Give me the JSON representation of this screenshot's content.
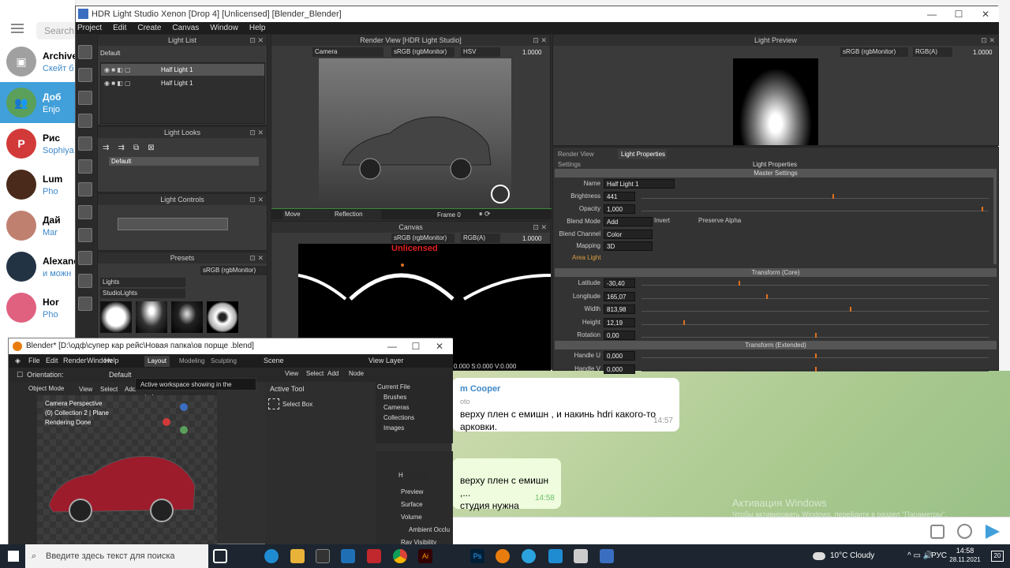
{
  "telegram": {
    "search_placeholder": "Search",
    "chats": [
      {
        "name": "Archive",
        "sub": "Скейт б",
        "color": "#a0a0a0",
        "initial": "▣"
      },
      {
        "name": "Доб",
        "sub": "Enjo",
        "color": "#5aa05a",
        "initial": "👥",
        "selected": true
      },
      {
        "name": "Рис",
        "sub": "Sophiya",
        "color": "#d23a3a",
        "initial": "P"
      },
      {
        "name": "Lum",
        "sub": "Pho",
        "color": "#4a2a1a",
        "initial": ""
      },
      {
        "name": "Дай",
        "sub": "Mar",
        "color": "#c08070",
        "initial": ""
      },
      {
        "name": "Alexand",
        "sub": "и можн",
        "color": "#223344",
        "initial": ""
      },
      {
        "name": "Hor",
        "sub": "Pho",
        "color": "#e06080",
        "initial": ""
      }
    ],
    "messages": [
      {
        "sender": "m Cooper",
        "sub": "oto",
        "text1": "верху плен с емишн , и накинь hdri какого-то",
        "text2": "арковки.",
        "time": "14:57"
      },
      {
        "text1": "верху плен с емишн ,...",
        "text2": "студия нужна",
        "time": "14:58"
      }
    ],
    "watermark1": "Активация Windows",
    "watermark2": "Чтобы активировать Windows, перейдите в раздел \"Параметры\"."
  },
  "hdr": {
    "title": "HDR Light Studio Xenon [Drop 4]  [Unlicensed] [Blender_Blender]",
    "menu": [
      "Project",
      "Edit",
      "Create",
      "Canvas",
      "Window",
      "Help"
    ],
    "light_list": {
      "title": "Light List",
      "group": "Default",
      "lights": [
        "Half Light 1",
        "Half Light 1"
      ]
    },
    "light_looks": {
      "title": "Light Looks",
      "item": "Default"
    },
    "light_controls": {
      "title": "Light Controls"
    },
    "presets": {
      "title": "Presets",
      "colorspace": "sRGB (rgbMonitor)",
      "category": "Lights",
      "sub": "StudioLights"
    },
    "render_view": {
      "title": "Render View [HDR Light Studio]",
      "camera": "Camera",
      "colorspace": "sRGB (rgbMonitor)",
      "mode": "HSV",
      "exposure": "1.0000",
      "move": "Move",
      "reflection": "Reflection",
      "frame": "Frame 0"
    },
    "canvas": {
      "title": "Canvas",
      "colorspace": "sRGB (rgbMonitor)",
      "mode": "RGB(A)",
      "exposure": "1.0000",
      "unlicensed": "Unlicensed",
      "coords": "0.000 S:0.000 V:0.000"
    },
    "light_preview": {
      "title": "Light Preview",
      "colorspace": "sRGB (rgbMonitor)",
      "mode": "RGB(A)",
      "exposure": "1.0000"
    },
    "tabs": [
      "Render View Settings",
      "Light Properties"
    ],
    "props": {
      "title": "Light Properties",
      "master": "Master Settings",
      "name_label": "Name",
      "name": "Half Light 1",
      "brightness_label": "Brightness",
      "brightness": "441",
      "opacity_label": "Opacity",
      "opacity": "1,000",
      "blend_mode_label": "Blend Mode",
      "blend_mode": "Add",
      "invert": "Invert",
      "preserve_alpha": "Preserve Alpha",
      "blend_channel_label": "Blend Channel",
      "blend_channel": "Color",
      "mapping_label": "Mapping",
      "mapping": "3D",
      "area_light": "Area Light",
      "transform_core": "Transform (Core)",
      "latitude_label": "Latitude",
      "latitude": "-30,40",
      "longitude_label": "Longitude",
      "longitude": "165,07",
      "width_label": "Width",
      "width": "813,98",
      "height_label": "Height",
      "height": "12,19",
      "rotation_label": "Rotation",
      "rotation": "0,00",
      "transform_ext": "Transform (Extended)",
      "handle_u_label": "Handle U",
      "handle_u": "0,000",
      "handle_v_label": "Handle V",
      "handle_v": "0,000"
    }
  },
  "blender": {
    "title": "Blender* [D:\\одф\\супер кар рейс\\Новая папка\\ов порще .blend]",
    "menu": [
      "File",
      "Edit",
      "Render",
      "Window",
      "Help"
    ],
    "tabs": [
      "Layout",
      "Modeling",
      "Sculpting"
    ],
    "scene": "Scene",
    "view_layer": "View Layer",
    "orientation": "Orientation:",
    "orientation_val": "Default",
    "object_mode": "Object Mode",
    "view": "View",
    "select": "Select",
    "add": "Add",
    "tooltip": "Active workspace showing in the window.",
    "vp_info": [
      "Camera Perspective",
      "(0) Collection 2 | Plane",
      "Rendering Done"
    ],
    "active_tool": "Active Tool",
    "select_box": "Select Box",
    "node_menu": [
      "View",
      "Select",
      "Add",
      "Node"
    ],
    "outliner": [
      "Current File",
      "Brushes",
      "Cameras",
      "Collections",
      "Images"
    ],
    "props": [
      "Preview",
      "Surface",
      "Volume",
      "Ambient Occlu",
      "Ray Visibility"
    ],
    "mat": "H"
  },
  "taskbar": {
    "search_placeholder": "Введите здесь текст для поиска",
    "weather": "10°C  Cloudy",
    "lang": "РУС",
    "time": "14:58",
    "date": "28.11.2021",
    "notif": "20"
  }
}
